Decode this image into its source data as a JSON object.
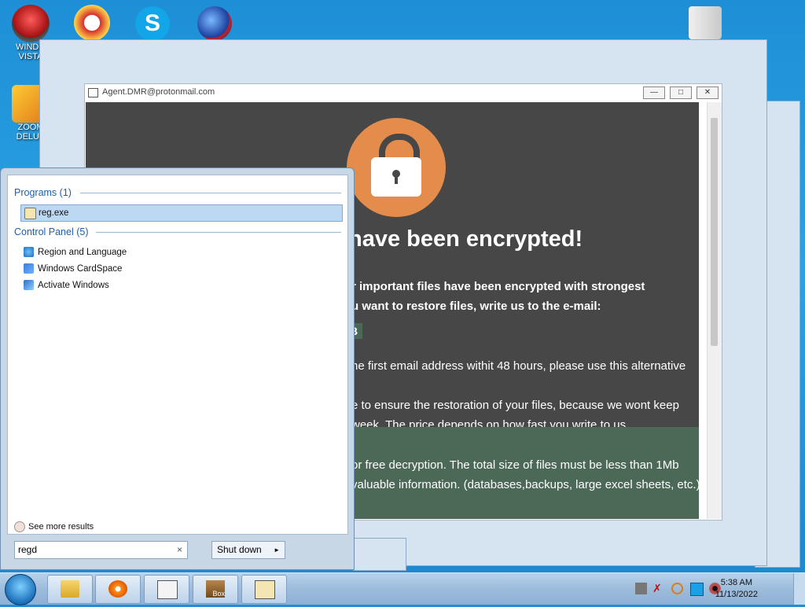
{
  "desktop": {
    "icons": [
      {
        "label_line1": "WINDO",
        "label_line2": "VISTA"
      },
      {
        "label_line1": "ZOOM",
        "label_line2": "DELUX"
      }
    ]
  },
  "ransom_window": {
    "title": "Agent.DMR@protonmail.com",
    "heading": "have been encrypted!",
    "line1": "r important files have been encrypted with strongest",
    "line2": "u want to restore files, write us to the e-mail:",
    "email_tag": "B",
    "line3": "he first email address withit 48 hours, please use this alternative",
    "line4": "e to ensure the restoration of your files, because we wont keep",
    "line5": "week. The price depends on how fast you write to us.",
    "line6": "or free decryption. The total size of files must be less than 1Mb",
    "line7": "valuable information. (databases,backups, large excel sheets, etc.)",
    "buttons": {
      "minimize": "—",
      "maximize": "□",
      "close": "✕"
    }
  },
  "start_menu": {
    "programs_header": "Programs (1)",
    "programs": [
      {
        "label": "reg.exe",
        "icon": "reg-exe-icon"
      }
    ],
    "control_panel_header": "Control Panel (5)",
    "control_panel": [
      {
        "label": "Region and Language",
        "icon": "globe-icon"
      },
      {
        "label": "Windows CardSpace",
        "icon": "cardspace-icon"
      },
      {
        "label": "Activate Windows",
        "icon": "activate-windows-icon"
      }
    ],
    "see_more": "See more results",
    "search_value": "regd",
    "clear": "×",
    "shutdown_label": "Shut down",
    "shutdown_arrow": "►"
  },
  "taskbar": {
    "clock_time": "5:38 AM",
    "clock_date": "11/13/2022",
    "tb_box_label": "Box"
  },
  "colors": {
    "accent": "#1e5fa8",
    "ransom_bg": "#474747",
    "lock_orange": "#e38c4b",
    "highlight_green": "#4c6958"
  }
}
